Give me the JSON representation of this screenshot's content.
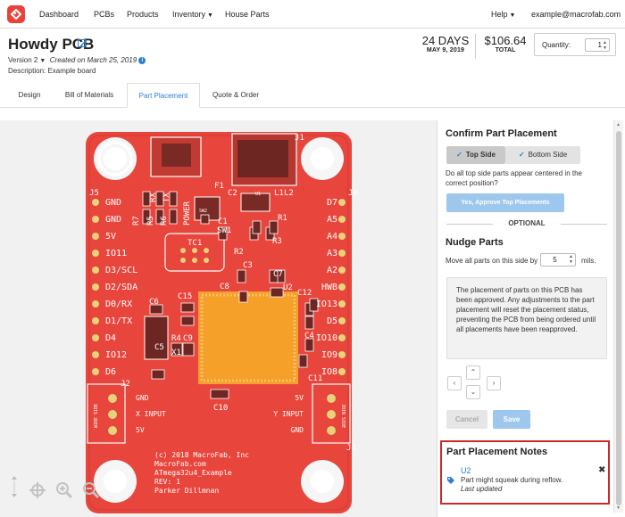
{
  "nav": {
    "items": [
      "Dashboard",
      "PCBs",
      "Products",
      "Inventory",
      "House Parts"
    ],
    "help": "Help",
    "user": "example@macrofab.com"
  },
  "header": {
    "title": "Howdy PCB",
    "version": "Version 2",
    "created": "Created on March 25, 2019",
    "description": "Description: Example board",
    "days": "24 DAYS",
    "date": "MAY 9, 2019",
    "price": "$106.64",
    "total": "TOTAL",
    "quantity_label": "Quantity:",
    "quantity_value": "1"
  },
  "tabs": [
    "Design",
    "Bill of Materials",
    "Part Placement",
    "Quote & Order"
  ],
  "active_tab": "Part Placement",
  "board": {
    "left_pins": [
      "GND",
      "GND",
      "5V",
      "IO11",
      "D3/SCL",
      "D2/SDA",
      "D0/RX",
      "D1/TX",
      "D4",
      "IO12",
      "D6"
    ],
    "right_pins": [
      "D7",
      "A5",
      "A4",
      "A3",
      "A2",
      "HWB",
      "IO13",
      "D5",
      "IO10",
      "IO9",
      "IO8"
    ],
    "refs": [
      "J1",
      "F1",
      "C2",
      "C1",
      "L1",
      "L2",
      "SW1",
      "R1",
      "R2",
      "R3",
      "TC1",
      "C3",
      "C7",
      "C8",
      "U2",
      "C12",
      "C15",
      "C6",
      "R4",
      "C9",
      "X1",
      "C4",
      "C5",
      "C10",
      "C11",
      "J2",
      "J3",
      "J5",
      "J4",
      "U1",
      "R5",
      "R6",
      "R7",
      "TX",
      "RX",
      "POWER",
      "SW2"
    ],
    "bottom_labels": [
      "GND",
      "X INPUT",
      "5V",
      "5V",
      "Y INPUT",
      "GND"
    ],
    "side_labels": [
      "WIRE SIDE",
      "JOIN SIDE"
    ],
    "silkscreen": [
      "(c) 2018 MacroFab, Inc",
      "MacroFab.com",
      "ATmega32u4_Example",
      "REV: 1",
      "Parker Dillmnan"
    ],
    "colors": {
      "board": "#e8453c",
      "silk": "#ffffff",
      "chip": "#f5a028",
      "pad": "#e9d27a"
    }
  },
  "panel": {
    "confirm_title": "Confirm Part Placement",
    "top_side": "Top Side",
    "bottom_side": "Bottom Side",
    "question": "Do all top side parts appear centered in the correct position?",
    "approve": "Yes, Approve Top Placements",
    "optional": "OPTIONAL",
    "nudge_title": "Nudge Parts",
    "nudge_text": "Move all parts on this side by",
    "nudge_value": "5",
    "nudge_unit": "mils.",
    "notice": "The placement of parts on this PCB has been approved. Any adjustments to the part placement will reset the placement status, preventing the PCB from being ordered until all placements have been reapproved.",
    "cancel": "Cancel",
    "save": "Save",
    "notes_title": "Part Placement Notes",
    "note_part": "U2",
    "note_msg": "Part might squeak during reflow.",
    "note_updated": "Last updated"
  }
}
